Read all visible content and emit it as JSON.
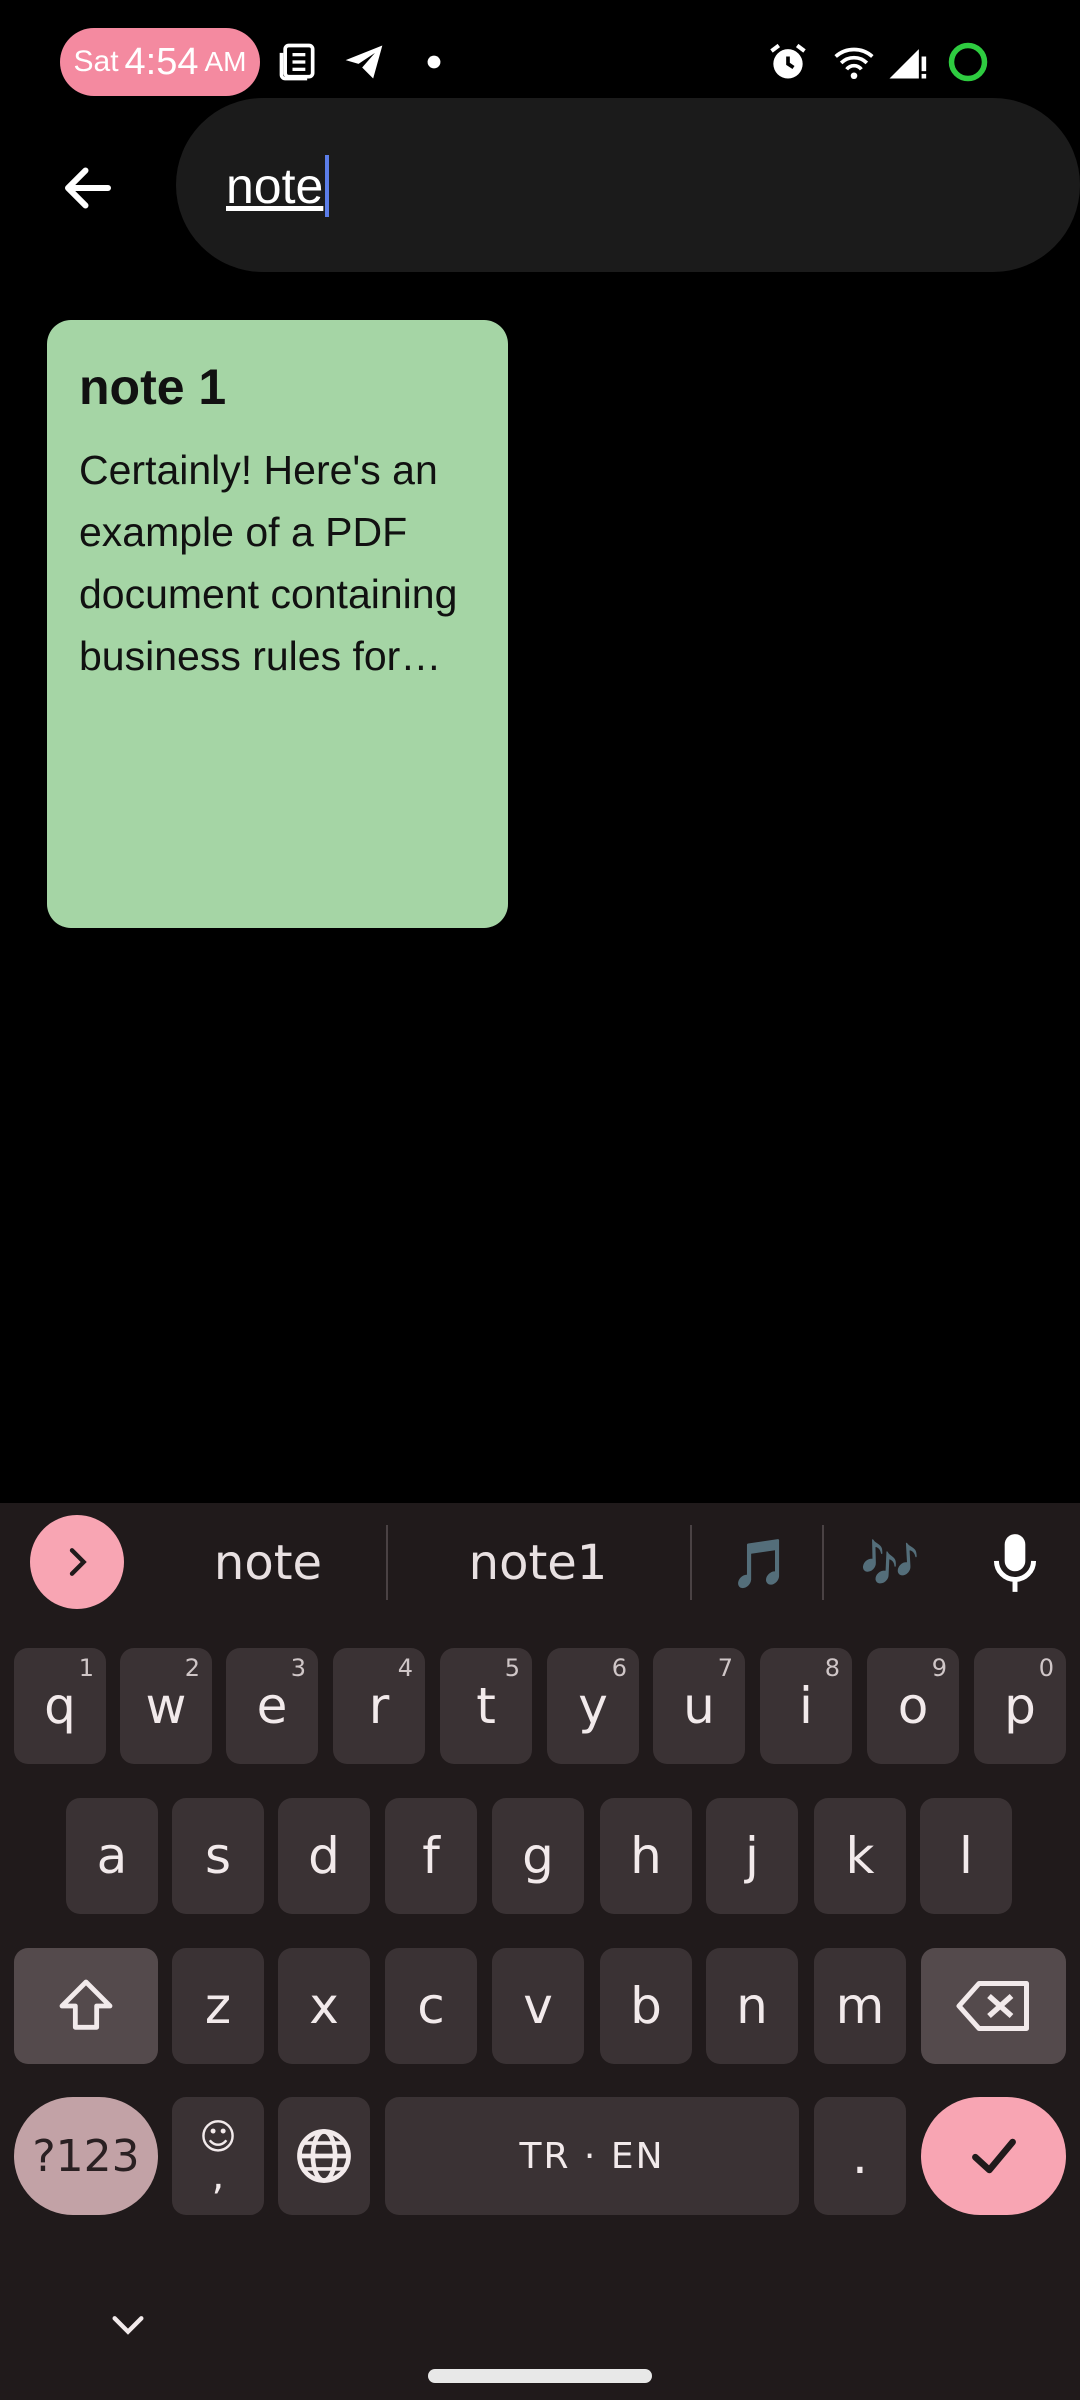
{
  "status_bar": {
    "day": "Sat",
    "time": "4:54",
    "ampm": "AM",
    "icons": [
      "news-icon",
      "telegram-icon",
      "dot-icon",
      "alarm-icon",
      "wifi-icon",
      "signal-icon",
      "battery-ring-icon"
    ]
  },
  "search": {
    "query": "note",
    "back_icon": "arrow-left-icon"
  },
  "notes": [
    {
      "title": "note 1",
      "body": "Certainly! Here's an example of a PDF document containing business rules for…",
      "color": "#a5d5a5"
    }
  ],
  "keyboard": {
    "suggestions": [
      "note",
      "note1"
    ],
    "emoji_suggestions": [
      "🎵",
      "🎶"
    ],
    "row1": [
      {
        "k": "q",
        "h": "1"
      },
      {
        "k": "w",
        "h": "2"
      },
      {
        "k": "e",
        "h": "3"
      },
      {
        "k": "r",
        "h": "4"
      },
      {
        "k": "t",
        "h": "5"
      },
      {
        "k": "y",
        "h": "6"
      },
      {
        "k": "u",
        "h": "7"
      },
      {
        "k": "i",
        "h": "8"
      },
      {
        "k": "o",
        "h": "9"
      },
      {
        "k": "p",
        "h": "0"
      }
    ],
    "row2": [
      "a",
      "s",
      "d",
      "f",
      "g",
      "h",
      "j",
      "k",
      "l"
    ],
    "row3": [
      "z",
      "x",
      "c",
      "v",
      "b",
      "n",
      "m"
    ],
    "symbols_label": "?123",
    "comma_label": ",",
    "space_label": "TR · EN",
    "period_label": ".",
    "accent_color": "#f8a5b3"
  }
}
